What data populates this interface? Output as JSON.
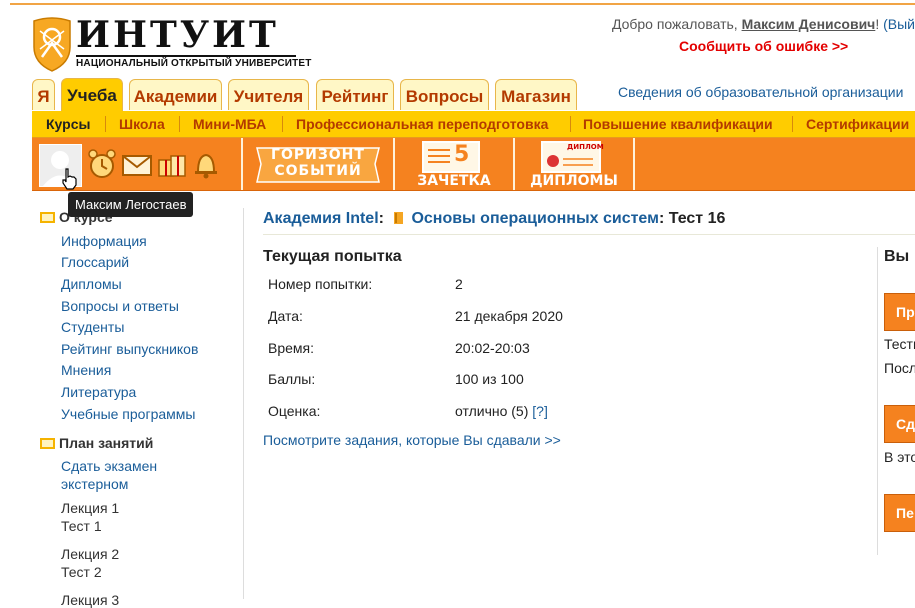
{
  "header": {
    "logo_word": "ИНТУИТ",
    "logo_sub": "НАЦИОНАЛЬНЫЙ ОТКРЫТЫЙ УНИВЕРСИТЕТ",
    "welcome_prefix": "Добро пожаловать, ",
    "user_name": "Максим Денисович",
    "welcome_suffix": "! ",
    "exit_link": "(Вый",
    "report_error": "Сообщить об ошибке >>",
    "org_info": "Сведения об образовательной организации"
  },
  "tabs": [
    "Я",
    "Учеба",
    "Академии",
    "Учителя",
    "Рейтинг",
    "Вопросы",
    "Магазин"
  ],
  "active_tab": "Учеба",
  "subnav": [
    "Курсы",
    "Школа",
    "Мини-МБА",
    "Профессиональная переподготовка",
    "Повышение квалификации",
    "Сертификации"
  ],
  "toolbar": {
    "tile1_line1": "ГОРИЗОНТ",
    "tile1_line2": "СОБЫТИЙ",
    "tile2_label": "ЗАЧЕТКА",
    "tile2_digit": "5",
    "tile3_label": "ДИПЛОМЫ",
    "tile3_badge": "ДИПЛОМ",
    "icons": [
      "alarm-clock-icon",
      "envelope-icon",
      "gifts-icon",
      "bell-icon"
    ]
  },
  "tooltip": "Максим Легостаев",
  "sidebar": {
    "section1_title": "О курсе",
    "links": [
      "Информация",
      "Глоссарий",
      "Дипломы",
      "Вопросы и ответы",
      "Студенты",
      "Рейтинг выпускников",
      "Мнения",
      "Литература",
      "Учебные программы"
    ],
    "section2_title": "План занятий",
    "extern_line1": "Сдать экзамен",
    "extern_line2": "экстерном",
    "lessons": [
      {
        "title": "Лекция 1",
        "test": "Тест 1"
      },
      {
        "title": "Лекция 2",
        "test": "Тест 2"
      },
      {
        "title": "Лекция 3",
        "test": ""
      }
    ]
  },
  "breadcrumb": {
    "academy": "Академия Intel",
    "sep": ": ",
    "course": "Основы операционных систем",
    "test": ": Тест 16"
  },
  "attempt": {
    "title": "Текущая попытка",
    "rows": [
      {
        "label": "Номер попытки:",
        "value": "2"
      },
      {
        "label": "Дата:",
        "value": "21 декабря 2020"
      },
      {
        "label": "Время:",
        "value": "20:02-20:03"
      },
      {
        "label": "Баллы:",
        "value": "100 из 100"
      },
      {
        "label": "Оценка:",
        "value": "отлично (5)"
      }
    ],
    "help": "[?]",
    "tasks_link": "Посмотрите задания, которые Вы сдавали >>"
  },
  "right": {
    "heading": "Вы",
    "btn1": "Пр",
    "text1": "Тести",
    "text2": "Посл",
    "btn2": "Сд",
    "text3": "В это",
    "btn3": "Пе"
  }
}
